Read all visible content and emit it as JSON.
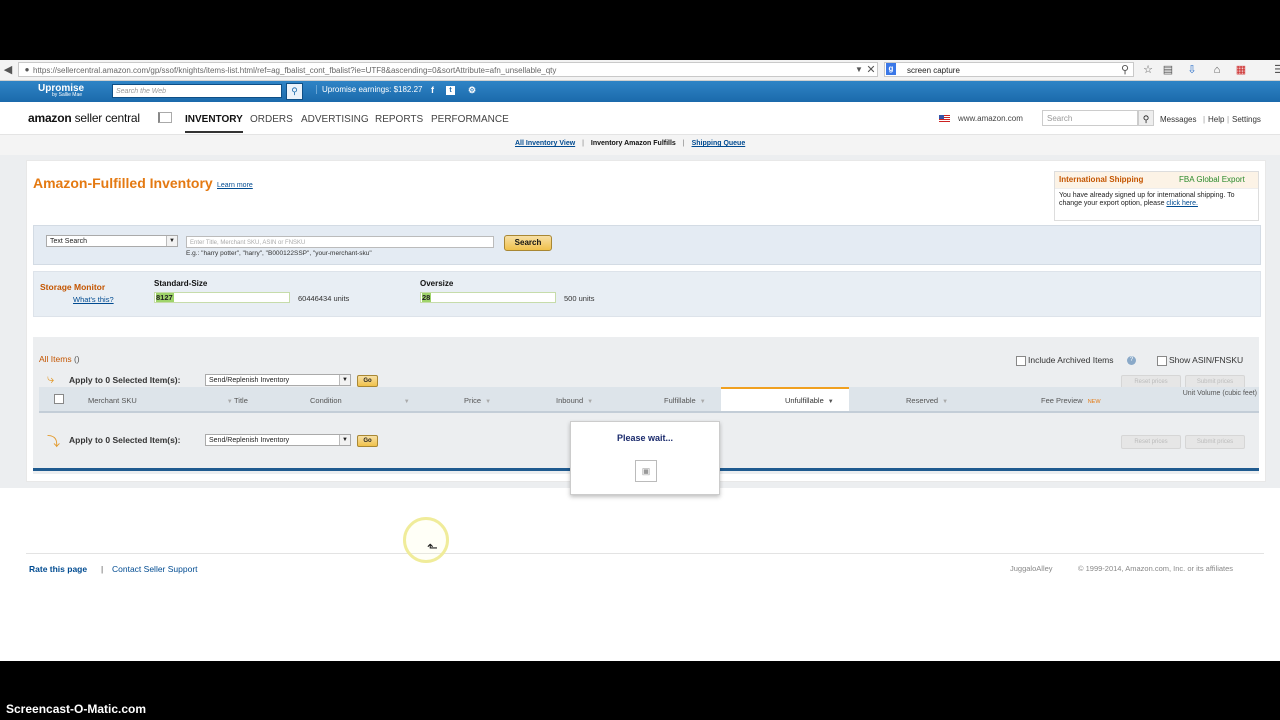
{
  "browser": {
    "url": "https://sellercentral.amazon.com/gp/ssof/knights/items-list.html/ref=ag_fbalist_cont_fbalist?ie=UTF8&ascending=0&sortAttribute=afn_unsellable_qty",
    "search_value": "screen capture"
  },
  "toolbar": {
    "logo": "Upromise",
    "logo_sub": "by Sallie Mae",
    "search_placeholder": "Search the Web",
    "earnings": "Upromise earnings: $182.27",
    "facebook": "f",
    "twitter": "t"
  },
  "header": {
    "logo_bold": "amazon",
    "logo_rest": " seller central",
    "tabs": [
      "INVENTORY",
      "ORDERS",
      "ADVERTISING",
      "REPORTS",
      "PERFORMANCE"
    ],
    "marketplace": "www.amazon.com",
    "search_placeholder": "Search",
    "links": [
      "Messages",
      "Help",
      "Settings"
    ]
  },
  "subnav": {
    "all_inventory": "All Inventory View",
    "current": "Inventory Amazon Fulfills",
    "shipping_queue": "Shipping Queue"
  },
  "page": {
    "title": "Amazon-Fulfilled Inventory",
    "learn_more": "Learn more"
  },
  "intl": {
    "title": "International Shipping",
    "export": "FBA Global Export",
    "body": "You have already signed up for international shipping. To change your export option, please",
    "link": "click here."
  },
  "search": {
    "type_selected": "Text Search",
    "placeholder": "Enter Title, Merchant SKU, ASIN or FNSKU",
    "hint": "E.g.: \"harry potter\", \"harry\", \"B000122SSP\", \"your-merchant-sku\"",
    "button": "Search"
  },
  "storage": {
    "label": "Storage Monitor",
    "whats_this": "What's this?",
    "standard_title": "Standard-Size",
    "standard_used": "8127",
    "standard_limit": "60446434 units",
    "standard_fraction": 0.0001,
    "oversize_title": "Oversize",
    "oversize_used": "28",
    "oversize_limit": "500 units",
    "oversize_fraction": 0.056
  },
  "items": {
    "all_items": "All Items",
    "count": "()",
    "include_archived": "Include Archived Items",
    "show_asin": "Show ASIN/FNSKU",
    "apply": "Apply to 0 Selected Item(s):",
    "action": "Send/Replenish Inventory",
    "go": "Go",
    "reset_prices": "Reset prices",
    "submit_prices": "Submit prices",
    "columns": [
      "Merchant SKU",
      "Title",
      "Condition",
      "Price",
      "Inbound",
      "Fulfillable",
      "Unfulfillable",
      "Reserved",
      "Fee Preview",
      "Unit Volume (cubic feet)"
    ],
    "new_badge": "NEW"
  },
  "modal": {
    "title": "Please wait..."
  },
  "footer": {
    "rate": "Rate this page",
    "sep": "|",
    "contact": "Contact Seller Support",
    "store": "JuggaloAlley",
    "copyright": "© 1999-2014, Amazon.com, Inc. or its affiliates"
  },
  "watermark": "Screencast-O-Matic.com",
  "colors": {
    "accent_orange": "#e47911",
    "link_blue": "#004b91",
    "toolbar_blue": "#1b6aab"
  }
}
